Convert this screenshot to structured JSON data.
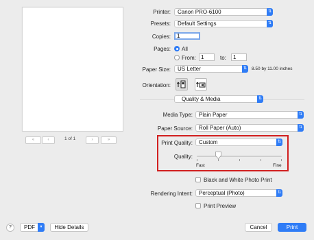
{
  "preview": {
    "page_label": "1 of 1",
    "first_icon": "«",
    "prev_icon": "‹",
    "next_icon": "›",
    "last_icon": "»"
  },
  "printer": {
    "label": "Printer:",
    "value": "Canon PRO-6100"
  },
  "presets": {
    "label": "Presets:",
    "value": "Default Settings"
  },
  "copies": {
    "label": "Copies:",
    "value": "1"
  },
  "pages": {
    "label": "Pages:",
    "all_label": "All",
    "from_label": "From:",
    "from_value": "1",
    "to_label": "to:",
    "to_value": "1",
    "selected": "All"
  },
  "paper_size": {
    "label": "Paper Size:",
    "value": "US Letter",
    "dimensions": "8.50 by 11.00 inches"
  },
  "orientation": {
    "label": "Orientation:",
    "selected": "portrait",
    "icons": [
      "portrait-icon",
      "landscape-icon"
    ]
  },
  "panel": {
    "value": "Quality & Media"
  },
  "media_type": {
    "label": "Media Type:",
    "value": "Plain Paper"
  },
  "paper_source": {
    "label": "Paper Source:",
    "value": "Roll Paper (Auto)"
  },
  "print_quality": {
    "label": "Print Quality:",
    "value": "Custom"
  },
  "quality": {
    "label": "Quality:",
    "min_label": "Fast",
    "max_label": "Fine",
    "level": 0.25
  },
  "bw_photo": {
    "label": "Black and White Photo Print",
    "checked": false
  },
  "rendering_intent": {
    "label": "Rendering Intent:",
    "value": "Perceptual (Photo)"
  },
  "print_preview": {
    "label": "Print Preview",
    "checked": false
  },
  "bottom": {
    "help": "?",
    "pdf": "PDF",
    "hide_details": "Hide Details",
    "cancel": "Cancel",
    "print": "Print"
  },
  "colors": {
    "accent": "#2f7cf6",
    "highlight": "#d11f1f"
  }
}
